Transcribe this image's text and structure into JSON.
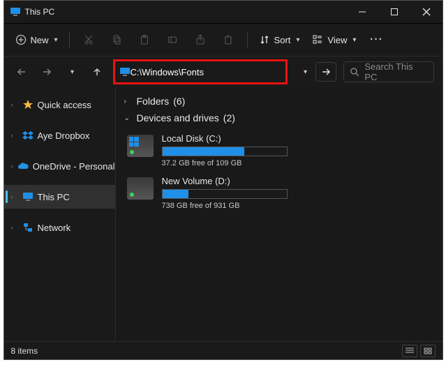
{
  "window": {
    "title": "This PC"
  },
  "toolbar": {
    "new_label": "New",
    "sort_label": "Sort",
    "view_label": "View"
  },
  "address": {
    "value": "C:\\Windows\\Fonts"
  },
  "search": {
    "placeholder": "Search This PC"
  },
  "sidebar": {
    "items": [
      {
        "label": "Quick access"
      },
      {
        "label": "Aye Dropbox"
      },
      {
        "label": "OneDrive - Personal"
      },
      {
        "label": "This PC"
      },
      {
        "label": "Network"
      }
    ]
  },
  "groups": {
    "folders": {
      "label": "Folders",
      "count": "(6)"
    },
    "devices": {
      "label": "Devices and drives",
      "count": "(2)"
    }
  },
  "drives": [
    {
      "name": "Local Disk (C:)",
      "free_text": "37.2 GB free of 109 GB",
      "fill_pct": 66
    },
    {
      "name": "New Volume (D:)",
      "free_text": "738 GB free of 931 GB",
      "fill_pct": 21
    }
  ],
  "status": {
    "items_text": "8 items"
  }
}
